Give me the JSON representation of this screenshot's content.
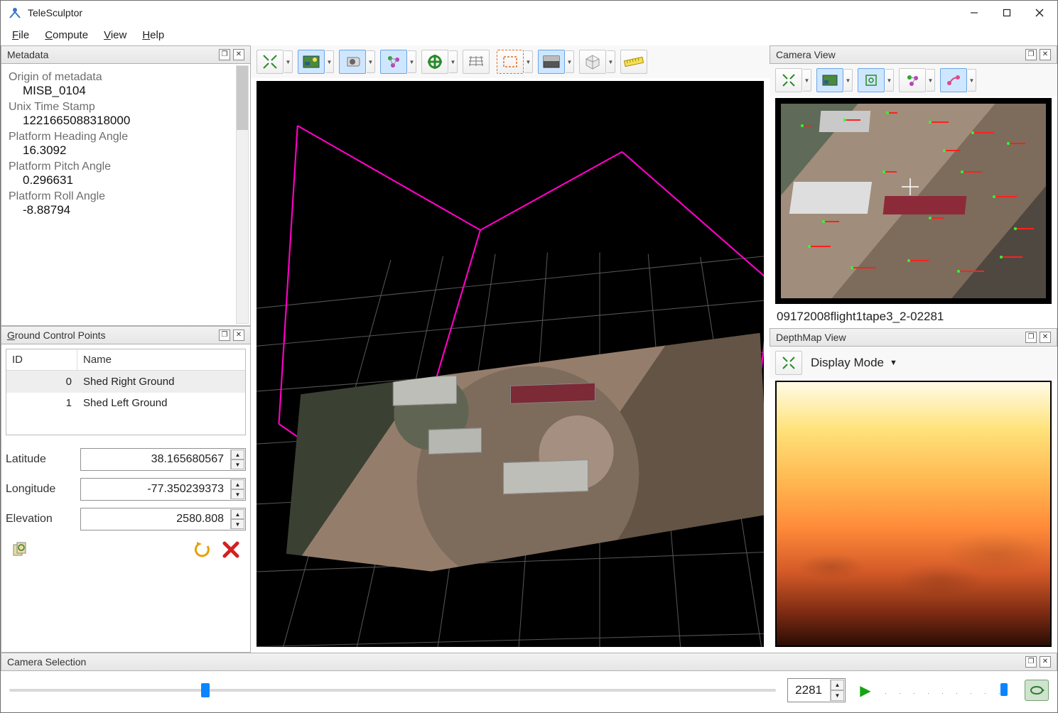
{
  "app": {
    "title": "TeleSculptor"
  },
  "menus": {
    "file": "File",
    "compute": "Compute",
    "view": "View",
    "help": "Help"
  },
  "panels": {
    "metadata_title": "Metadata",
    "gcp_title": "Ground Control Points",
    "camera_view_title": "Camera View",
    "depth_title": "DepthMap View",
    "camera_sel_title": "Camera Selection"
  },
  "metadata": {
    "origin_label": "Origin of metadata",
    "origin_value": "MISB_0104",
    "unix_label": "Unix Time Stamp",
    "unix_value": "1221665088318000",
    "heading_label": "Platform Heading Angle",
    "heading_value": "16.3092",
    "pitch_label": "Platform Pitch Angle",
    "pitch_value": "0.296631",
    "roll_label": "Platform Roll Angle",
    "roll_value": "-8.88794"
  },
  "gcp": {
    "headers": {
      "id": "ID",
      "name": "Name"
    },
    "rows": [
      {
        "id": "0",
        "name": "Shed Right Ground"
      },
      {
        "id": "1",
        "name": "Shed Left Ground"
      }
    ],
    "latitude_label": "Latitude",
    "latitude_value": "38.165680567",
    "longitude_label": "Longitude",
    "longitude_value": "-77.350239373",
    "elevation_label": "Elevation",
    "elevation_value": "2580.808"
  },
  "camera_view": {
    "caption": "09172008flight1tape3_2-02281"
  },
  "depth": {
    "display_mode_label": "Display Mode"
  },
  "camera_sel": {
    "frame": "2281"
  }
}
